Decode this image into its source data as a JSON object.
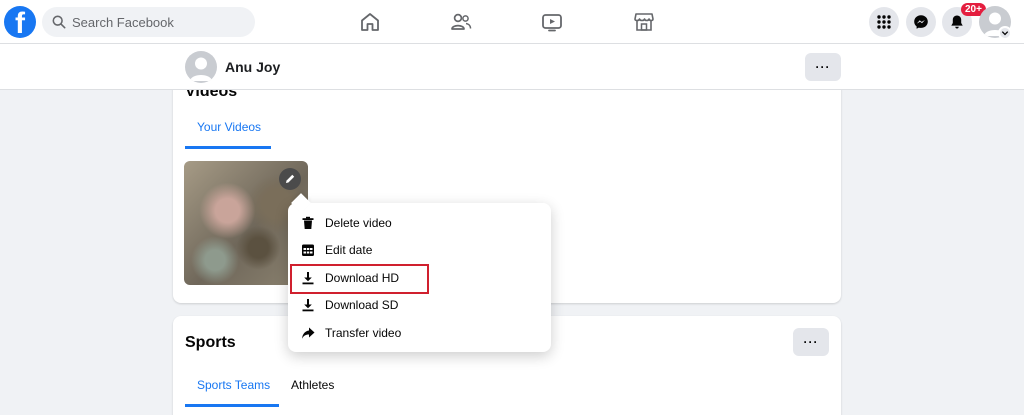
{
  "header": {
    "logo_letter": "f",
    "search_placeholder": "Search Facebook",
    "notification_count": "20+"
  },
  "profile": {
    "name": "Anu Joy",
    "more_label": "···"
  },
  "videos_section": {
    "title": "Videos",
    "tabs": [
      {
        "label": "Your Videos"
      }
    ]
  },
  "video_menu": {
    "items": [
      {
        "label": "Delete video",
        "icon": "trash-icon"
      },
      {
        "label": "Edit date",
        "icon": "calendar-icon"
      },
      {
        "label": "Download HD",
        "icon": "download-icon"
      },
      {
        "label": "Download SD",
        "icon": "download-icon"
      },
      {
        "label": "Transfer video",
        "icon": "share-arrow-icon"
      }
    ]
  },
  "sports_section": {
    "title": "Sports",
    "more_label": "···",
    "tabs": [
      {
        "label": "Sports Teams"
      },
      {
        "label": "Athletes"
      }
    ]
  },
  "colors": {
    "accent": "#1877f2",
    "highlight": "#d0202e",
    "badge": "#e41e3f"
  }
}
